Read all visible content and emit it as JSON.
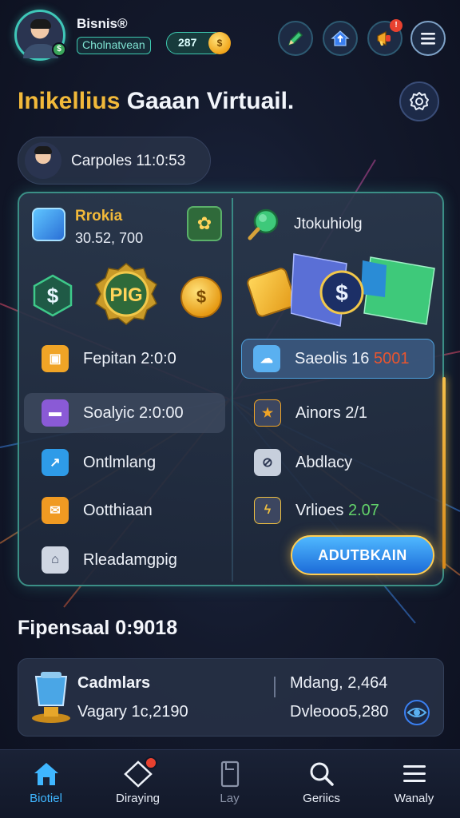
{
  "header": {
    "user_name": "Bisnis®",
    "user_handle": "Cholnatvean",
    "coin_count": "287",
    "coin_symbol": "$",
    "avatar_badge": "$",
    "notification_badge": "!",
    "icons": [
      "pen-icon",
      "home-upload-icon",
      "megaphone-icon",
      "menu-icon"
    ]
  },
  "title": {
    "part1": "Inikellius",
    "part2": " Gaaan Virtuail."
  },
  "profile": {
    "label": "Carpoles 11:0:53"
  },
  "left_card": {
    "title": "Rrokia",
    "value": "30.52, 700",
    "badge_text": "PIG",
    "coin_symbol": "$",
    "hex_symbol": "$",
    "rows": [
      {
        "label": "Fepitan 2:0:0",
        "icon": "shopping-bag-icon",
        "icon_color": "#f0a426",
        "selected": false
      },
      {
        "label": "Soalyic 2:0:00",
        "icon": "ticket-icon",
        "icon_color": "#8a5ad6",
        "selected": true
      },
      {
        "label": "Ontlmlang",
        "icon": "chart-up-icon",
        "icon_color": "#2e9be8",
        "selected": false
      },
      {
        "label": "Ootthiaan",
        "icon": "envelope-icon",
        "icon_color": "#f09a22",
        "selected": false
      },
      {
        "label": "Rleadamgpig",
        "icon": "bank-icon",
        "icon_color": "#cfd6e2",
        "selected": false
      }
    ]
  },
  "right_card": {
    "title": "Jtokuhiolg",
    "coin_symbol": "$",
    "rows": [
      {
        "label": "Saeolis 16 ",
        "highlight": "5001",
        "icon": "chat-icon",
        "icon_color": "#5ab0f0",
        "selected": true
      },
      {
        "label": "Ainors 2/1",
        "icon": "star-icon",
        "icon_color": "#f0a426",
        "selected": false
      },
      {
        "label": "Abdlacy",
        "icon": "eye-slash-icon",
        "icon_color": "#c7cfdc",
        "selected": false
      },
      {
        "label": "Vrlioes ",
        "highlight": "2.07",
        "icon": "bolt-icon",
        "icon_color": "#f0c040",
        "selected": false
      }
    ],
    "cta_label": "ADUTBKAIN"
  },
  "summary": {
    "section_title": "Fipensaal 0:9018",
    "line1_left": "Cadmlars",
    "line2_left": "Vagary 1c,2190",
    "line1_right": "Mdang, 2,464",
    "line2_right": "Dvleooo5,280"
  },
  "bottom_nav": [
    {
      "label": "Biotiel",
      "icon": "home-icon",
      "active": true
    },
    {
      "label": "Diraying",
      "icon": "diamond-icon",
      "badge": true
    },
    {
      "label": "Lay",
      "icon": "document-icon",
      "dim": true
    },
    {
      "label": "Geriics",
      "icon": "search-icon"
    },
    {
      "label": "Wanaly",
      "icon": "menu-icon"
    }
  ],
  "colors": {
    "accent_teal": "#3ec9b0",
    "accent_gold": "#f2b93a",
    "accent_blue": "#3fb6ff",
    "highlight_red": "#e8552f",
    "highlight_green": "#63d36a"
  }
}
